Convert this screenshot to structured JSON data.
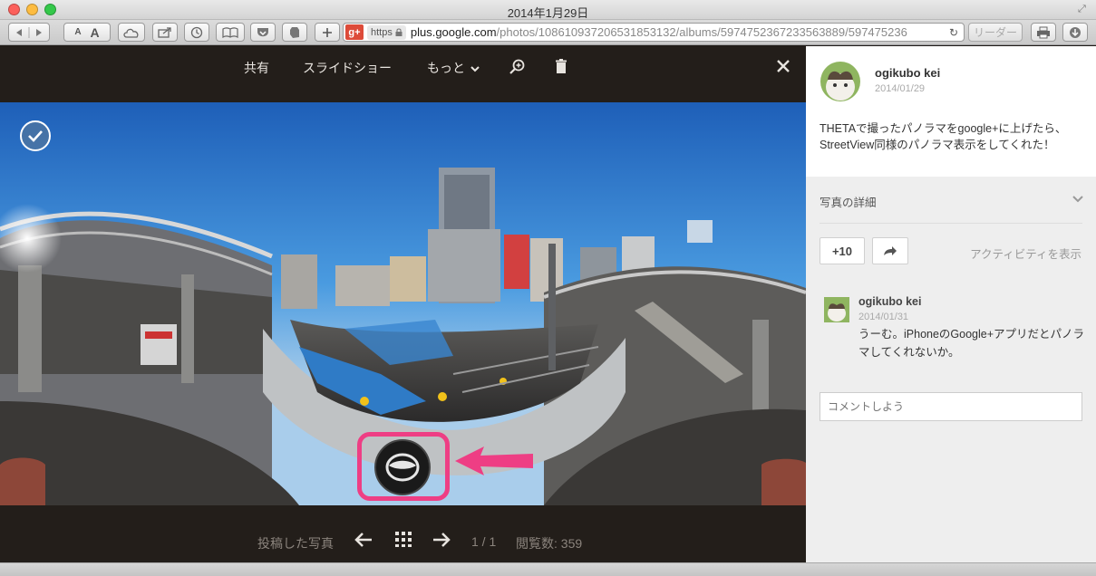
{
  "window": {
    "title": "2014年1月29日"
  },
  "browser": {
    "url_host": "plus.google.com",
    "url_path": "/photos/108610937206531853132/albums/5974752367233563889/597475236",
    "https_label": "https",
    "reader_label": "リーダー",
    "gplus_label": "g+"
  },
  "viewer": {
    "menu": {
      "share": "共有",
      "slideshow": "スライドショー",
      "more": "もっと"
    },
    "bottom": {
      "posted_photos": "投稿した写真",
      "counter": "1 / 1",
      "views": "閲覧数: 359"
    }
  },
  "sidebar": {
    "post": {
      "author": "ogikubo kei",
      "date": "2014/01/29",
      "text": "THETAで撮ったパノラマをgoogle+に上げたら、StreetView同様のパノラマ表示をしてくれた！"
    },
    "details_label": "写真の詳細",
    "plus_label": "+10",
    "activity_label": "アクティビティを表示",
    "comment": {
      "author": "ogikubo kei",
      "date": "2014/01/31",
      "text": "うーむ。iPhoneのGoogle+アプリだとパノラマしてくれないか。"
    },
    "comment_placeholder": "コメントしよう"
  },
  "colors": {
    "highlight": "#ee3e84",
    "gplus_red": "#dd4b39",
    "viewer_bg": "#231e1a"
  }
}
